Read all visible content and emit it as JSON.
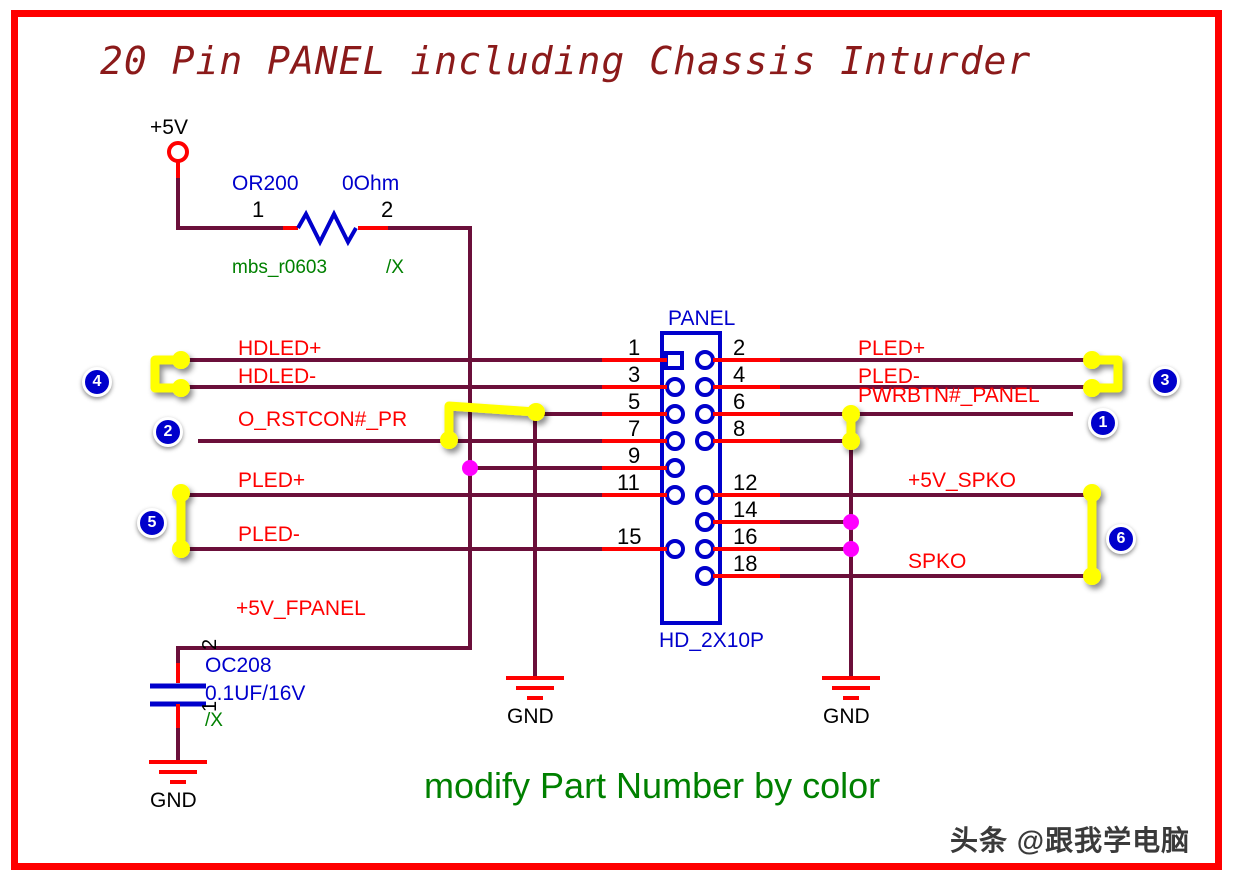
{
  "diagram": {
    "title": "20 Pin PANEL including Chassis Inturder",
    "footer_note": "modify Part Number by color",
    "watermark": "头条 @跟我学电脑",
    "border_color": "#ff0000",
    "wire_color": "#6b0f3a",
    "pin_stub_color": "#ff0000",
    "symbol_color": "#0000cc",
    "net_label_color": "#ff0000",
    "highlight_color": "#ffff00",
    "junction_color": "#ff00ff",
    "badge_color": "#0000cc",
    "title_color": "#8b1a1a",
    "footer_color": "#008000"
  },
  "power": {
    "supply_label": "+5V",
    "fpanel_label": "+5V_FPANEL"
  },
  "resistor": {
    "designator": "OR200",
    "value": "0Ohm",
    "footprint": "mbs_r0603",
    "variant": "/X",
    "pin1": "1",
    "pin2": "2"
  },
  "capacitor": {
    "designator": "OC208",
    "value": "0.1UF/16V",
    "variant": "/X",
    "pin1": "1",
    "pin2": "2"
  },
  "connector": {
    "name": "PANEL",
    "footprint": "HD_2X10P",
    "left_pins": [
      "1",
      "3",
      "5",
      "7",
      "9",
      "11",
      "15"
    ],
    "right_pins": [
      "2",
      "4",
      "6",
      "8",
      "12",
      "14",
      "16",
      "18"
    ]
  },
  "nets": {
    "left": [
      {
        "label": "HDLED+",
        "pin": "1"
      },
      {
        "label": "HDLED-",
        "pin": "3"
      },
      {
        "label": "O_RSTCON#_PR",
        "pin": "7"
      },
      {
        "label": "PLED+",
        "pin": "11"
      },
      {
        "label": "PLED-",
        "pin": "15"
      }
    ],
    "right": [
      {
        "label": "PLED+",
        "pin": "2"
      },
      {
        "label": "PLED-",
        "pin": "4"
      },
      {
        "label": "PWRBTN#_PANEL",
        "pin": "6"
      },
      {
        "label": "+5V_SPKO",
        "pin": "12"
      },
      {
        "label": "SPKO",
        "pin": "18"
      }
    ]
  },
  "ground_labels": [
    "GND",
    "GND",
    "GND"
  ],
  "badges": [
    {
      "number": "4",
      "side": "left"
    },
    {
      "number": "2",
      "side": "left"
    },
    {
      "number": "5",
      "side": "left"
    },
    {
      "number": "3",
      "side": "right"
    },
    {
      "number": "1",
      "side": "right"
    },
    {
      "number": "6",
      "side": "right"
    }
  ]
}
